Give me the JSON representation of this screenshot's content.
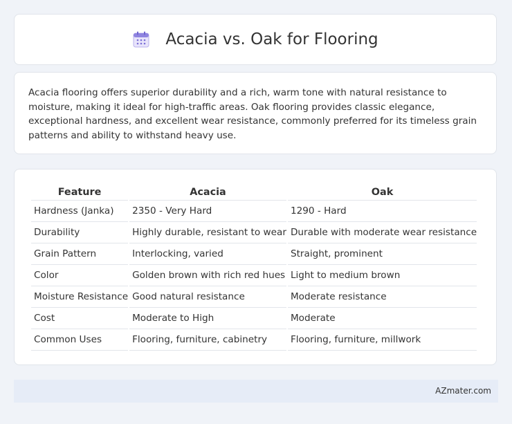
{
  "header": {
    "title": "Acacia vs. Oak for Flooring",
    "icon": "calendar-icon"
  },
  "summary": {
    "text": "Acacia flooring offers superior durability and a rich, warm tone with natural resistance to moisture, making it ideal for high-traffic areas. Oak flooring provides classic elegance, exceptional hardness, and excellent wear resistance, commonly preferred for its timeless grain patterns and ability to withstand heavy use."
  },
  "table": {
    "headers": [
      "Feature",
      "Acacia",
      "Oak"
    ],
    "rows": [
      [
        "Hardness (Janka)",
        "2350 - Very Hard",
        "1290 - Hard"
      ],
      [
        "Durability",
        "Highly durable, resistant to wear",
        "Durable with moderate wear resistance"
      ],
      [
        "Grain Pattern",
        "Interlocking, varied",
        "Straight, prominent"
      ],
      [
        "Color",
        "Golden brown with rich red hues",
        "Light to medium brown"
      ],
      [
        "Moisture Resistance",
        "Good natural resistance",
        "Moderate resistance"
      ],
      [
        "Cost",
        "Moderate to High",
        "Moderate"
      ],
      [
        "Common Uses",
        "Flooring, furniture, cabinetry",
        "Flooring, furniture, millwork"
      ]
    ]
  },
  "footer": {
    "source": "AZmater.com"
  },
  "colors": {
    "background": "#f0f3f8",
    "footer_background": "#e6ecf7",
    "icon_accent": "#7b6fd6"
  }
}
